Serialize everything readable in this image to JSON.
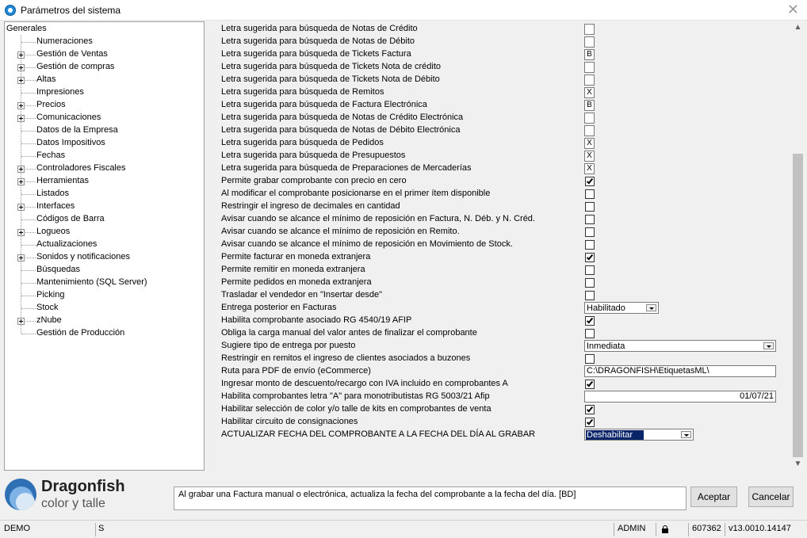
{
  "window": {
    "title": "Parámetros del sistema"
  },
  "tree": {
    "root": "Generales",
    "items": [
      {
        "label": "Numeraciones",
        "expandable": false
      },
      {
        "label": "Gestión de Ventas",
        "expandable": true
      },
      {
        "label": "Gestión de compras",
        "expandable": true
      },
      {
        "label": "Altas",
        "expandable": true
      },
      {
        "label": "Impresiones",
        "expandable": false
      },
      {
        "label": "Precios",
        "expandable": true
      },
      {
        "label": "Comunicaciones",
        "expandable": true
      },
      {
        "label": "Datos de la Empresa",
        "expandable": false
      },
      {
        "label": "Datos Impositivos",
        "expandable": false
      },
      {
        "label": "Fechas",
        "expandable": false
      },
      {
        "label": "Controladores Fiscales",
        "expandable": true
      },
      {
        "label": "Herramientas",
        "expandable": true
      },
      {
        "label": "Listados",
        "expandable": false
      },
      {
        "label": "Interfaces",
        "expandable": true
      },
      {
        "label": "Códigos de Barra",
        "expandable": false
      },
      {
        "label": "Logueos",
        "expandable": true
      },
      {
        "label": "Actualizaciones",
        "expandable": false
      },
      {
        "label": "Sonidos y notificaciones",
        "expandable": true
      },
      {
        "label": "Búsquedas",
        "expandable": false
      },
      {
        "label": "Mantenimiento (SQL Server)",
        "expandable": false
      },
      {
        "label": "Picking",
        "expandable": false
      },
      {
        "label": "Stock",
        "expandable": false
      },
      {
        "label": "zNube",
        "expandable": true
      },
      {
        "label": "Gestión de Producción",
        "expandable": false
      }
    ]
  },
  "settings": [
    {
      "label": "Letra sugerida para búsqueda de Notas de Crédito",
      "type": "letter",
      "value": ""
    },
    {
      "label": "Letra sugerida para búsqueda de Notas de Débito",
      "type": "letter",
      "value": ""
    },
    {
      "label": "Letra sugerida para búsqueda de Tickets Factura",
      "type": "letter",
      "value": "B"
    },
    {
      "label": "Letra sugerida para búsqueda de Tickets Nota de crédito",
      "type": "letter",
      "value": ""
    },
    {
      "label": "Letra sugerida para búsqueda de Tickets Nota de Débito",
      "type": "letter",
      "value": ""
    },
    {
      "label": "Letra sugerida para búsqueda de Remitos",
      "type": "letter",
      "value": "X"
    },
    {
      "label": "Letra sugerida para búsqueda de Factura Electrónica",
      "type": "letter",
      "value": "B"
    },
    {
      "label": "Letra sugerida para búsqueda de Notas de Crédito Electrónica",
      "type": "letter",
      "value": ""
    },
    {
      "label": "Letra sugerida para búsqueda de Notas de Débito Electrónica",
      "type": "letter",
      "value": ""
    },
    {
      "label": "Letra sugerida para búsqueda de Pedidos",
      "type": "letter",
      "value": "X"
    },
    {
      "label": "Letra sugerida para búsqueda de Presupuestos",
      "type": "letter",
      "value": "X"
    },
    {
      "label": "Letra sugerida para búsqueda de Preparaciones de Mercaderías",
      "type": "letter",
      "value": "X"
    },
    {
      "label": "Permite grabar comprobante con precio en cero",
      "type": "checkbox",
      "checked": true
    },
    {
      "label": "Al modificar el comprobante posicionarse en el primer ítem disponible",
      "type": "checkbox",
      "checked": false
    },
    {
      "label": "Restringir el ingreso de decimales en cantidad",
      "type": "checkbox",
      "checked": false
    },
    {
      "label": "Avisar cuando se alcance el mínimo de reposición en Factura, N. Déb. y N. Créd.",
      "type": "checkbox",
      "checked": false
    },
    {
      "label": "Avisar cuando se alcance el mínimo de reposición en Remito.",
      "type": "checkbox",
      "checked": false
    },
    {
      "label": "Avisar cuando se alcance el mínimo de reposición en Movimiento de Stock.",
      "type": "checkbox",
      "checked": false
    },
    {
      "label": "Permite facturar en moneda extranjera",
      "type": "checkbox",
      "checked": true
    },
    {
      "label": "Permite remitir en moneda extranjera",
      "type": "checkbox",
      "checked": false
    },
    {
      "label": "Permite pedidos en moneda extranjera",
      "type": "checkbox",
      "checked": false
    },
    {
      "label": "Trasladar el vendedor en \"Insertar desde\"",
      "type": "checkbox",
      "checked": false
    },
    {
      "label": "Entrega posterior en Facturas",
      "type": "combo",
      "value": "Habilitado",
      "size": "short"
    },
    {
      "label": "Habilita comprobante asociado RG 4540/19 AFIP",
      "type": "checkbox",
      "checked": true
    },
    {
      "label": "Obliga la carga manual del valor antes de finalizar el comprobante",
      "type": "checkbox",
      "checked": false
    },
    {
      "label": "Sugiere tipo de entrega por puesto",
      "type": "combo",
      "value": "Inmediata",
      "size": "long"
    },
    {
      "label": "Restringir en remitos el ingreso de clientes asociados a buzones",
      "type": "checkbox",
      "checked": false
    },
    {
      "label": "Ruta para PDF de envío (eCommerce)",
      "type": "text",
      "value": "C:\\DRAGONFISH\\EtiquetasML\\",
      "align": "left"
    },
    {
      "label": "Ingresar monto de descuento/recargo con IVA incluido en comprobantes A",
      "type": "checkbox",
      "checked": true
    },
    {
      "label": "Habilita comprobantes letra \"A\" para monotributistas RG 5003/21 Afip",
      "type": "text",
      "value": "01/07/21",
      "align": "right"
    },
    {
      "label": "Habilitar selección de color y/o talle de kits en comprobantes de venta",
      "type": "checkbox",
      "checked": true
    },
    {
      "label": "Habilitar circuito de consignaciones",
      "type": "checkbox",
      "checked": true
    },
    {
      "label": "ACTUALIZAR FECHA DEL COMPROBANTE A LA FECHA DEL DÍA AL GRABAR",
      "type": "combo",
      "value": "Deshabilitar",
      "size": "medium",
      "selected": true
    }
  ],
  "footer": {
    "brand": "Dragonfish",
    "tagline": "color y talle",
    "description": "Al grabar una Factura manual o electrónica, actualiza la fecha del comprobante a la fecha del día. [BD]",
    "accept_label": "Aceptar",
    "cancel_label": "Cancelar"
  },
  "statusbar": {
    "mode": "DEMO",
    "flag": "S",
    "user": "ADMIN",
    "serial": "607362",
    "version": "v13.0010.14147"
  }
}
